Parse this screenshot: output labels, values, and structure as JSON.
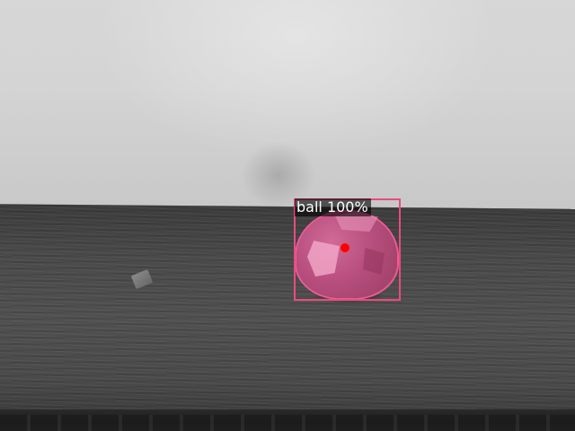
{
  "detection": {
    "label_text": "ball 100%",
    "class_name": "ball",
    "score_percent": 100,
    "box_color": "#e84c7d",
    "mask_color": "#b84f7f",
    "keypoint_color": "#ff0000"
  }
}
